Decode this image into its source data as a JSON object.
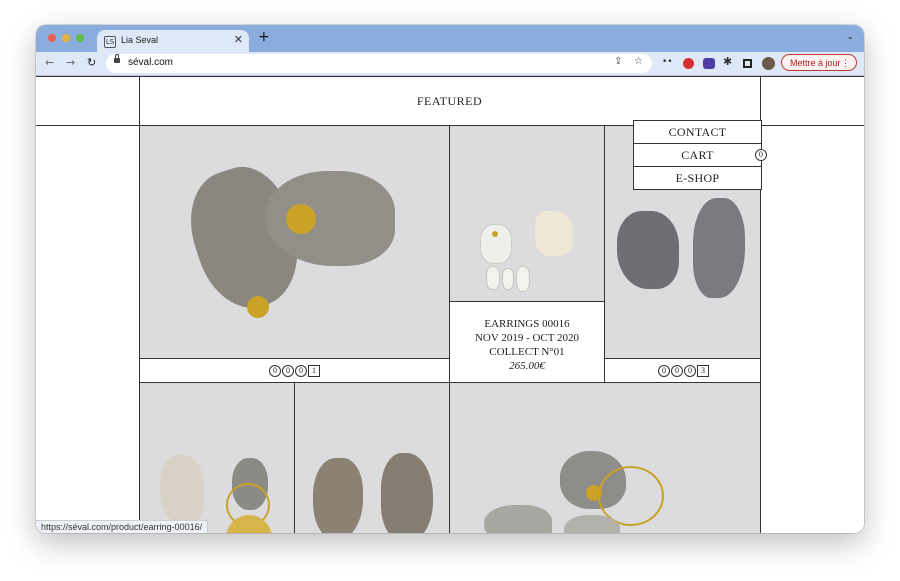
{
  "browser": {
    "tab_title": "Lia Seval",
    "tab_favicon": "LS",
    "url": "séval.com",
    "update_button": "Mettre à jour",
    "status_url": "https://séval.com/product/earring-00016/"
  },
  "page": {
    "heading": "FEATURED",
    "menu": {
      "contact": "CONTACT",
      "cart": "CART",
      "eshop": "E-SHOP",
      "cart_count": "0"
    },
    "product_1": {
      "dots": [
        "0",
        "0",
        "0"
      ],
      "index": "1"
    },
    "product_2": {
      "name": "EARRINGS 00016",
      "dates": "NOV 2019 - OCT 2020",
      "collection": "COLLECT N°01",
      "price": "265.00€"
    },
    "product_3": {
      "dots": [
        "0",
        "0",
        "0"
      ],
      "index": "3"
    }
  }
}
